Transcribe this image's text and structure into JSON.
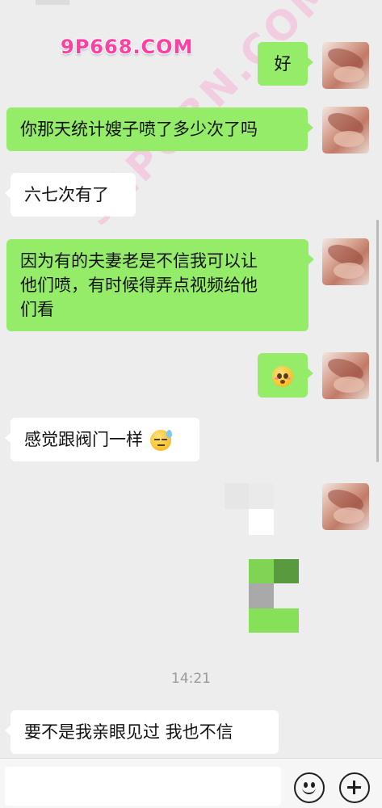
{
  "watermarks": {
    "top": "9P668.COM",
    "diagonal": "91PORN.COM"
  },
  "messages": [
    {
      "sender": "me",
      "text": "好"
    },
    {
      "sender": "me",
      "text": "你那天统计嫂子喷了多少次了吗"
    },
    {
      "sender": "other",
      "text": "六七次有了"
    },
    {
      "sender": "me",
      "lines": [
        "因为有的夫妻老是不信我可以让",
        "他们喷，有时候得弄点视频给他",
        "们看"
      ]
    },
    {
      "sender": "me",
      "emoji": "flushed-face-emoji"
    },
    {
      "sender": "other",
      "text": "感觉跟阀门一样",
      "emoji": "downcast-sweat-face-emoji"
    },
    {
      "sender": "me",
      "type": "censored-image"
    },
    {
      "sender": "other",
      "text": "要不是我亲眼见过 我也不信"
    }
  ],
  "timestamp": "14:21",
  "colors": {
    "background": "#ededed",
    "my_bubble": "#95ec69",
    "other_bubble": "#ffffff",
    "watermark": "#ff3fa2"
  },
  "input_bar": {
    "emoji_icon": "smiley-icon",
    "plus_icon": "plus-icon"
  }
}
